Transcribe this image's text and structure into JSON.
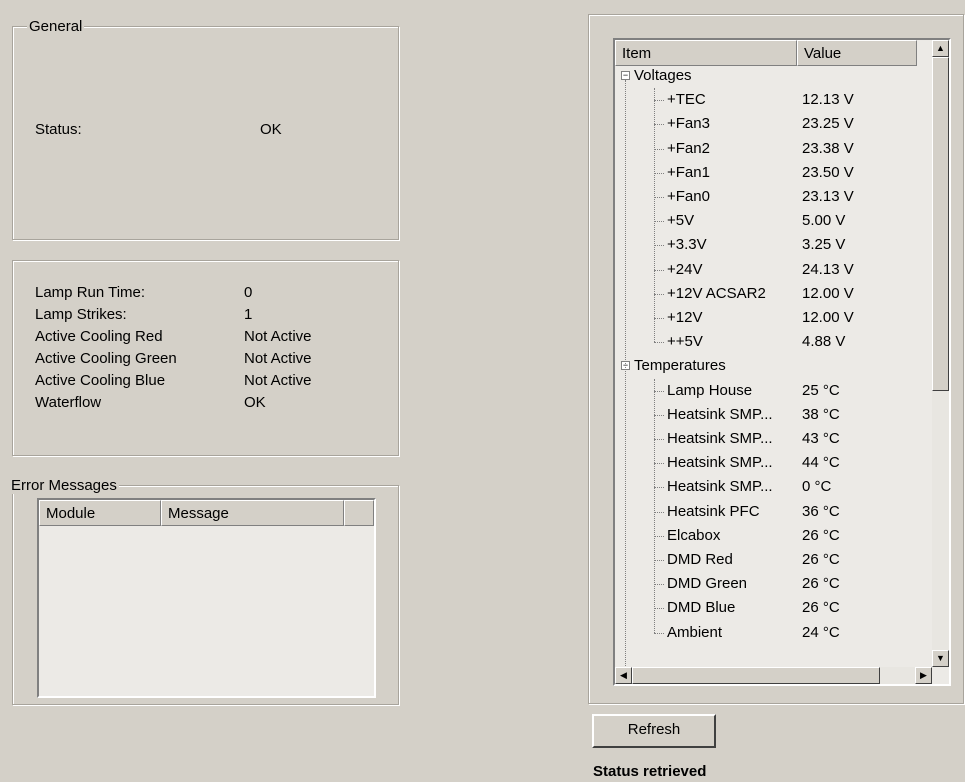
{
  "general": {
    "title": "General",
    "status_label": "Status:",
    "status_value": "OK"
  },
  "lamp_info": [
    {
      "label": "Lamp Run Time:",
      "value": "0"
    },
    {
      "label": "Lamp Strikes:",
      "value": "1"
    },
    {
      "label": "Active Cooling Red",
      "value": "Not Active"
    },
    {
      "label": "Active Cooling Green",
      "value": "Not Active"
    },
    {
      "label": "Active Cooling Blue",
      "value": "Not Active"
    },
    {
      "label": "Waterflow",
      "value": "OK"
    }
  ],
  "errors": {
    "title": "Error Messages",
    "columns": [
      "Module",
      "Message"
    ]
  },
  "tree": {
    "columns": [
      "Item",
      "Value"
    ],
    "groups": [
      {
        "label": "Voltages",
        "expander": "−",
        "items": [
          {
            "label": "+TEC",
            "value": "12.13 V"
          },
          {
            "label": "+Fan3",
            "value": "23.25 V"
          },
          {
            "label": "+Fan2",
            "value": "23.38 V"
          },
          {
            "label": "+Fan1",
            "value": "23.50 V"
          },
          {
            "label": "+Fan0",
            "value": "23.13 V"
          },
          {
            "label": "+5V",
            "value": "5.00 V"
          },
          {
            "label": "+3.3V",
            "value": "3.25 V"
          },
          {
            "label": "+24V",
            "value": "24.13 V"
          },
          {
            "label": "+12V ACSAR2",
            "value": "12.00 V"
          },
          {
            "label": "+12V",
            "value": "12.00 V"
          },
          {
            "label": "++5V",
            "value": "4.88 V"
          }
        ]
      },
      {
        "label": "Temperatures",
        "expander": "−",
        "items": [
          {
            "label": "Lamp House",
            "value": "25 °C"
          },
          {
            "label": "Heatsink SMP...",
            "value": "38 °C"
          },
          {
            "label": "Heatsink SMP...",
            "value": "43 °C"
          },
          {
            "label": "Heatsink SMP...",
            "value": "44 °C"
          },
          {
            "label": "Heatsink SMP...",
            "value": "0 °C"
          },
          {
            "label": "Heatsink PFC",
            "value": "36 °C"
          },
          {
            "label": "Elcabox",
            "value": "26 °C"
          },
          {
            "label": "DMD Red",
            "value": "26 °C"
          },
          {
            "label": "DMD Green",
            "value": "26 °C"
          },
          {
            "label": "DMD Blue",
            "value": "26 °C"
          },
          {
            "label": "Ambient",
            "value": "24 °C"
          }
        ]
      }
    ],
    "scroll_up": "▲",
    "scroll_down": "▼",
    "scroll_left": "◀",
    "scroll_right": "▶"
  },
  "refresh_label": "Refresh",
  "status_message": "Status retrieved"
}
